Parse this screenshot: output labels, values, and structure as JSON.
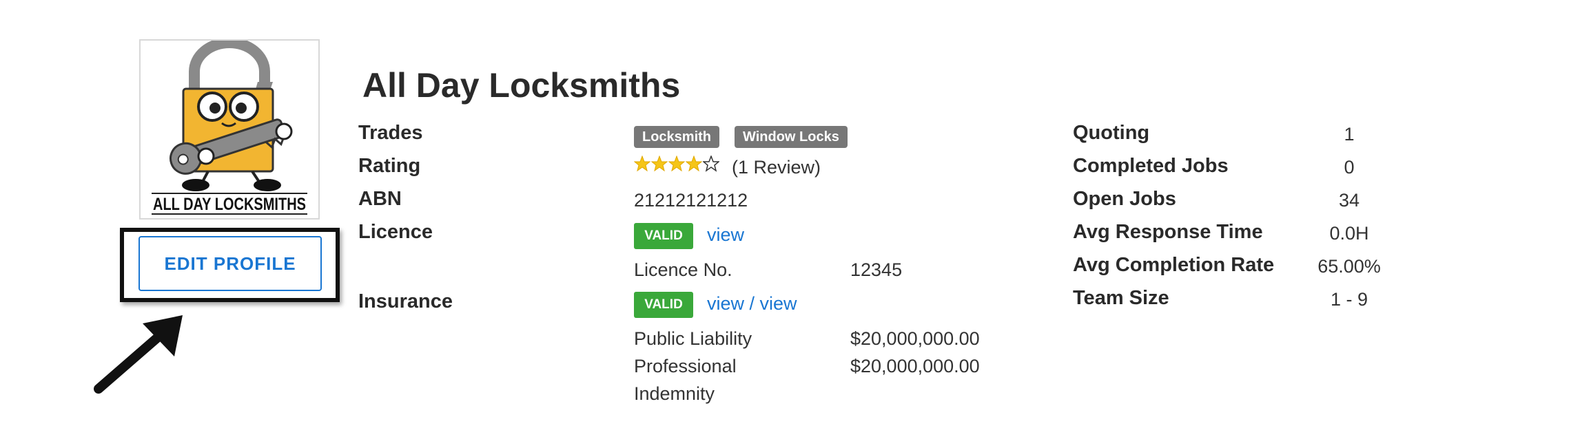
{
  "profile": {
    "logo_text": "ALL DAY LOCKSMITHS",
    "company_name": "All Day Locksmiths",
    "edit_button": "EDIT PROFILE"
  },
  "details": {
    "trades_label": "Trades",
    "trades": [
      "Locksmith",
      "Window Locks"
    ],
    "rating_label": "Rating",
    "rating": {
      "stars": 4,
      "max": 5,
      "reviews_text": "(1 Review)"
    },
    "abn_label": "ABN",
    "abn": "21212121212",
    "licence_label": "Licence",
    "licence_status": "VALID",
    "licence_link": "view",
    "licence_no_label": "Licence No.",
    "licence_no": "12345",
    "insurance_label": "Insurance",
    "insurance_status": "VALID",
    "insurance_links": "view / view",
    "public_liability_label": "Public Liability",
    "public_liability_value": "$20,000,000.00",
    "professional_indemnity_label_1": "Professional",
    "professional_indemnity_label_2": "Indemnity",
    "professional_indemnity_value": "$20,000,000.00"
  },
  "stats": [
    {
      "label": "Quoting",
      "value": "1"
    },
    {
      "label": "Completed Jobs",
      "value": "0"
    },
    {
      "label": "Open Jobs",
      "value": "34"
    },
    {
      "label": "Avg Response Time",
      "value": "0.0H"
    },
    {
      "label": "Avg Completion Rate",
      "value": "65.00%"
    },
    {
      "label": "Team Size",
      "value": "1 - 9"
    }
  ],
  "colors": {
    "link": "#1976d2",
    "valid": "#3aa83a",
    "tag": "#777777",
    "star": "#f5c518",
    "highlight": "#111111"
  },
  "icons": {
    "star": "star-icon",
    "arrow": "pointer-arrow-icon"
  }
}
